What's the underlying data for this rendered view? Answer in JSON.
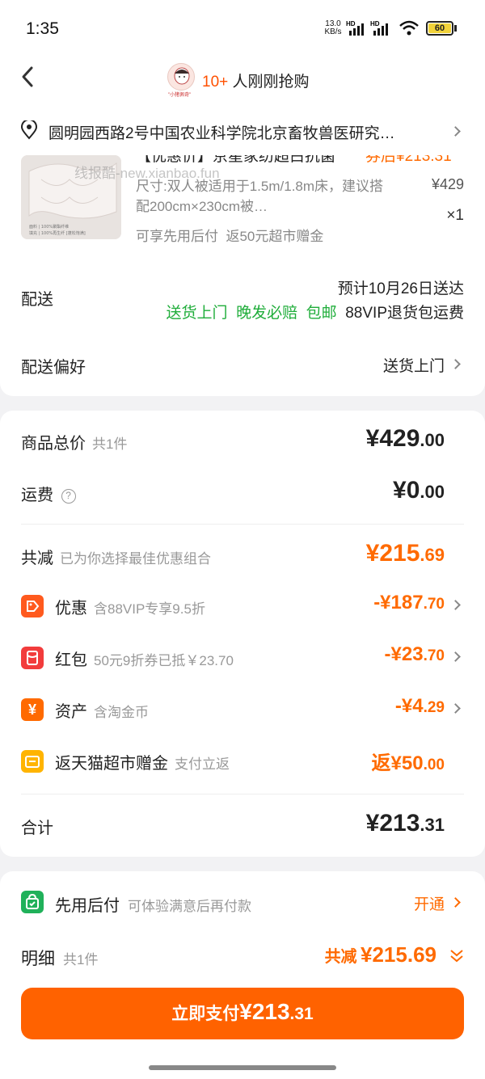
{
  "status_bar": {
    "time": "1:35",
    "net_speed_top": "13.0",
    "net_speed_bottom": "KB/s",
    "battery": "60"
  },
  "nav": {
    "count": "10+",
    "text": "人刚刚抢购",
    "avatar_caption": "\"小猪佩奇\""
  },
  "address": {
    "text": "圆明园西路2号中国农业科学院北京畜牧兽医研究…"
  },
  "product": {
    "title": "【优惠价】京星家纺超白抗菌",
    "price_hint": "券后¥213.31",
    "spec": "尺寸:双人被适用于1.5m/1.8m床，建议搭配200cm&times;230cm被…",
    "price": "¥429",
    "qty": "×1",
    "services": "可享先用后付  返50元超市赠金",
    "thumb_caption_1": "面料 | 100%聚酯纤维",
    "thumb_caption_2": "填充 | 100%再生纤 [蓬松饱满]",
    "watermark": "线报酷-new.xianbao.fun"
  },
  "delivery": {
    "label": "配送",
    "eta": "预计10月26日送达",
    "tags": [
      "送货上门",
      "晚发必赔",
      "包邮"
    ],
    "vip_tag": "88VIP退货包运费",
    "pref_label": "配送偏好",
    "pref_value": "送货上门"
  },
  "summary": {
    "total_label": "商品总价",
    "total_sub": "共1件",
    "total_big": "¥429",
    "total_small": ".00",
    "freight_label": "运费",
    "freight_help": "?",
    "freight_big": "¥0",
    "freight_small": ".00",
    "reduce_label": "共减",
    "reduce_sub": "已为你选择最佳优惠组合",
    "reduce_big": "¥215",
    "reduce_small": ".69",
    "discounts": [
      {
        "label": "优惠",
        "sub": "含88VIP专享9.5折",
        "big": "-¥187",
        "small": ".70",
        "color": "#ff5a1e"
      },
      {
        "label": "红包",
        "sub": "50元9折券已抵￥23.70",
        "big": "-¥23",
        "small": ".70",
        "color": "#f23c3c"
      },
      {
        "label": "资产",
        "sub": "含淘金币",
        "big": "-¥4",
        "small": ".29",
        "color": "#ff6a00"
      },
      {
        "label": "返天猫超市赠金",
        "sub": "支付立返",
        "big": "返¥50",
        "small": ".00",
        "color": "#ffb400"
      }
    ],
    "sum_label": "合计",
    "sum_big": "¥213",
    "sum_small": ".31"
  },
  "pay_later": {
    "label": "先用后付",
    "sub": "可体验满意后再付款",
    "action": "开通"
  },
  "detail": {
    "label": "明细",
    "sub": "共1件",
    "reduce_label": "共减",
    "reduce_value": "¥215.69"
  },
  "pay_button": {
    "label": "立即支付",
    "big": "¥213",
    "small": ".31"
  }
}
